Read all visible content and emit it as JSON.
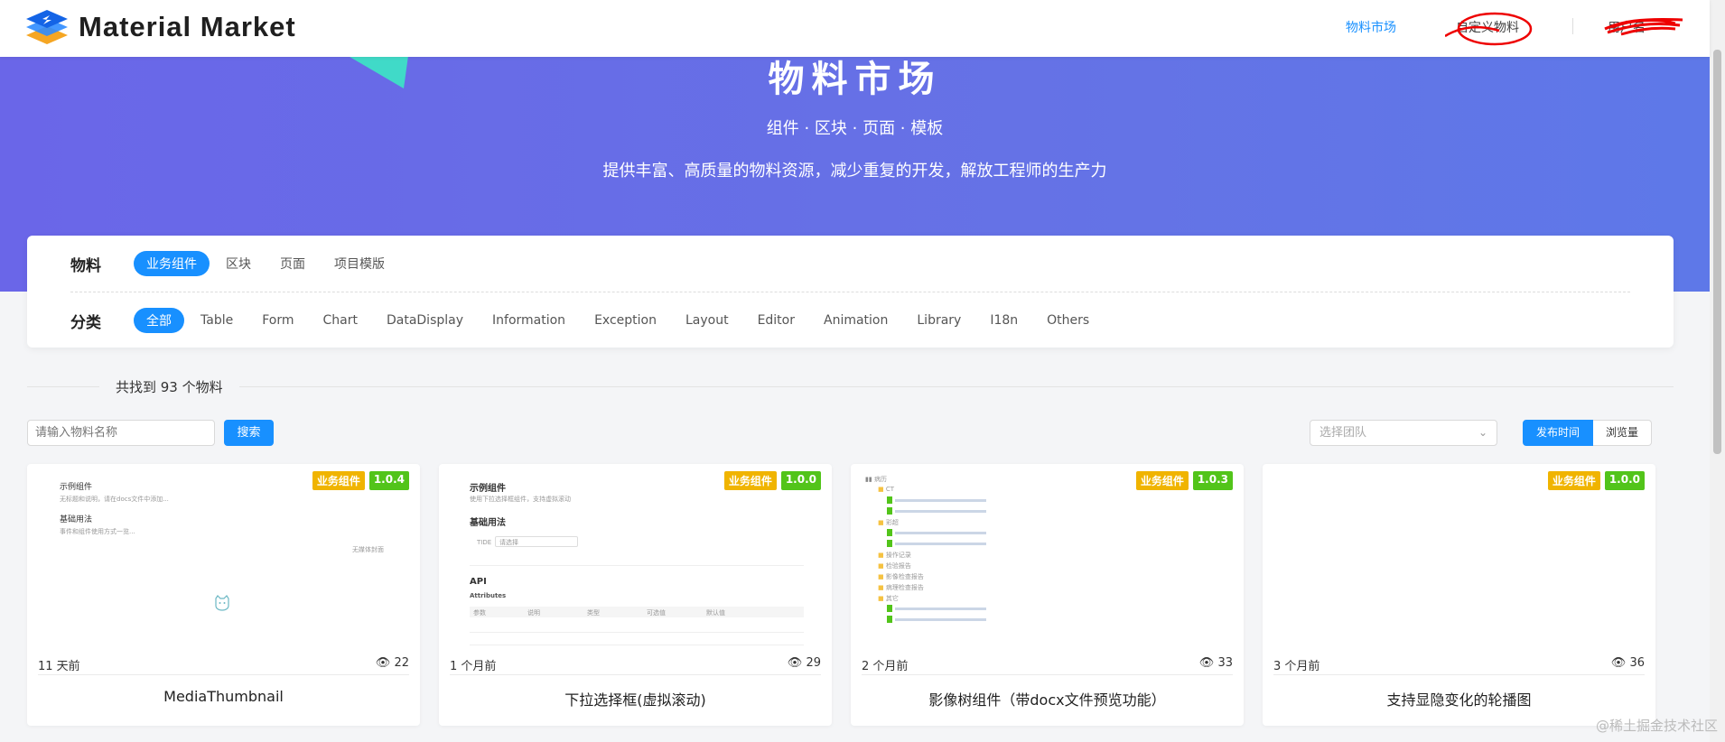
{
  "header": {
    "brand": "Material Market",
    "nav_market": "物料市场",
    "nav_custom": "自定义物料",
    "nav_user": "用户名"
  },
  "hero": {
    "title": "物料市场",
    "subtitle": "组件 · 区块 · 页面 · 模板",
    "description": "提供丰富、高质量的物料资源，减少重复的开发，解放工程师的生产力"
  },
  "filters": {
    "material_label": "物料",
    "materials": [
      "业务组件",
      "区块",
      "页面",
      "项目模版"
    ],
    "category_label": "分类",
    "categories": [
      "全部",
      "Table",
      "Form",
      "Chart",
      "DataDisplay",
      "Information",
      "Exception",
      "Layout",
      "Editor",
      "Animation",
      "Library",
      "I18n",
      "Others"
    ]
  },
  "results": {
    "found_text": "共找到 93 个物料",
    "search_placeholder": "请输入物料名称",
    "search_button": "搜索",
    "team_placeholder": "选择团队",
    "sort_time": "发布时间",
    "sort_views": "浏览量"
  },
  "cards": [
    {
      "type": "业务组件",
      "version": "1.0.4",
      "time": "11 天前",
      "views": "22",
      "title": "MediaThumbnail",
      "preview": {
        "h1": "示例组件",
        "p1": "无标题和说明，请在docs文件中添加...",
        "h2": "基础用法",
        "p2": "事件和组件使用方式一览...",
        "right": "无媒体封面"
      }
    },
    {
      "type": "业务组件",
      "version": "1.0.0",
      "time": "1 个月前",
      "views": "29",
      "title": "下拉选择框(虚拟滚动)",
      "preview": {
        "h1": "示例组件",
        "p1": "使用下拉选择框组件，支持虚拟滚动",
        "h2": "基础用法",
        "select_label": "TIDE",
        "select_value": "请选择",
        "api": "API",
        "attrs": "Attributes",
        "cols": [
          "参数",
          "说明",
          "类型",
          "可选值",
          "默认值"
        ]
      }
    },
    {
      "type": "业务组件",
      "version": "1.0.3",
      "time": "2 个月前",
      "views": "33",
      "title": "影像树组件（带docx文件预览功能）",
      "preview": {
        "root": "病历",
        "folders": [
          "CT",
          "彩超",
          "操作记录",
          "检验报告",
          "影像检查报告",
          "病理检查报告",
          "其它"
        ]
      }
    },
    {
      "type": "业务组件",
      "version": "1.0.0",
      "time": "3 个月前",
      "views": "36",
      "title": "支持显隐变化的轮播图",
      "preview": {}
    }
  ],
  "footer_watermark": "@稀土掘金技术社区",
  "colors": {
    "primary": "#1890ff",
    "hero": "#6a6ee8",
    "badge_type": "#f0b400",
    "badge_version": "#52c41a"
  }
}
